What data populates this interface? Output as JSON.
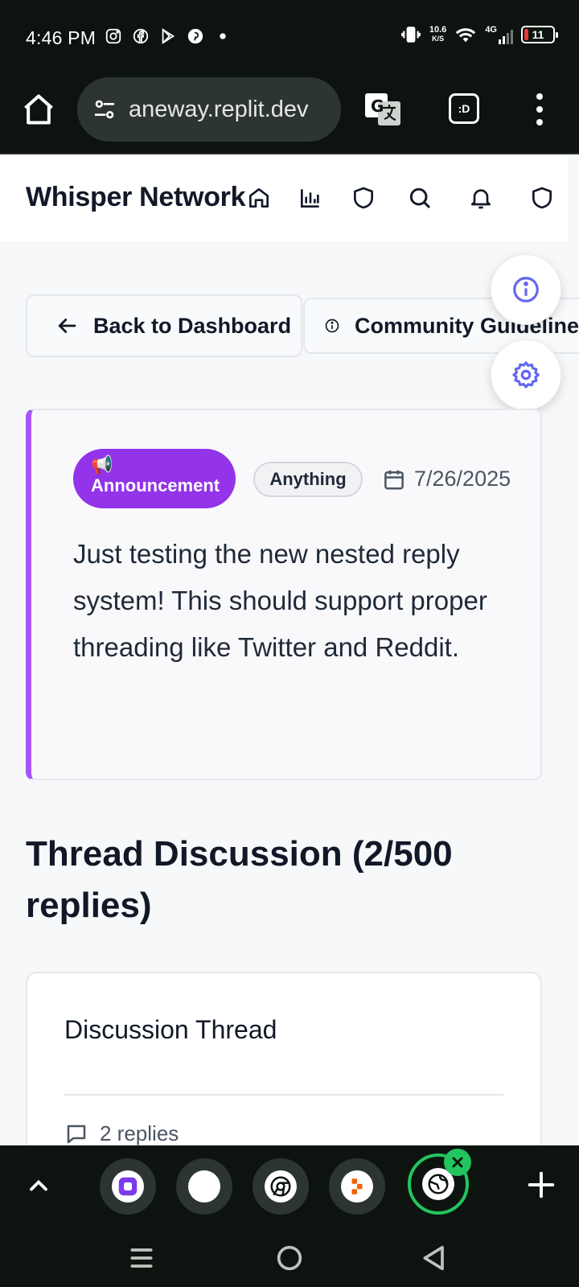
{
  "status_bar": {
    "time": "4:46 PM",
    "net_speed_value": "10.6",
    "net_speed_unit": "K/S",
    "network": "4G",
    "battery": "11"
  },
  "browser": {
    "url": "aneway.replit.dev",
    "tabs_label": ":D"
  },
  "app": {
    "title": "Whisper Network",
    "nav_icons": [
      "home-icon",
      "bar-chart-icon",
      "shield-icon",
      "search-icon",
      "bell-icon",
      "shield-icon"
    ]
  },
  "actions": {
    "back_label": "Back to Dashboard",
    "guidelines_label": "Community Guidelines"
  },
  "post": {
    "category_emoji": "📢",
    "category_label": "Announcement",
    "tag_label": "Anything",
    "date": "7/26/2025",
    "body": "Just testing the new nested reply system! This should support proper threading like Twitter and Reddit.",
    "accent_color": "#a855f7",
    "badge_color": "#9333ea"
  },
  "thread": {
    "heading": "Thread Discussion (2/500 replies)",
    "card_title": "Discussion Thread",
    "replies_label": "2 replies"
  },
  "colors": {
    "fab_icon": "#6366f1",
    "active_tab_ring": "#22c55e"
  }
}
